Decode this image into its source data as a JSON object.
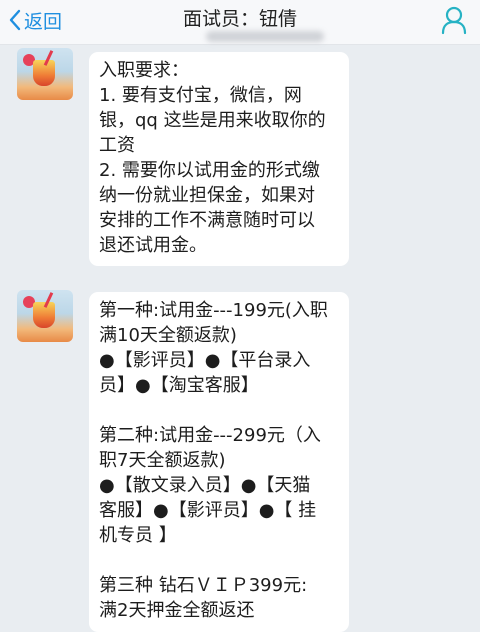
{
  "header": {
    "back_label": "返回",
    "title": "面试员：钮倩"
  },
  "messages": [
    {
      "lines": [
        "入职要求：",
        "1. 要有支付宝，微信，网",
        "银，qq 这些是用来收取你的",
        "工资",
        "2. 需要你以试用金的形式缴",
        "纳一份就业担保金，如果对",
        "安排的工作不满意随时可以",
        "退还试用金。"
      ]
    },
    {
      "lines": [
        "第一种:试用金---199元(入职",
        "满10天全额返款)",
        "●【影评员】●【平台录入",
        "员】●【淘宝客服】",
        "",
        "第二种:试用金---299元（入",
        "职7天全额返款)",
        "●【散文录入员】●【天猫",
        "客服】●【影评员】●【 挂",
        "机专员 】",
        "",
        "第三种 钻石ＶＩＰ399元:",
        "满2天押金全额返还"
      ]
    }
  ]
}
